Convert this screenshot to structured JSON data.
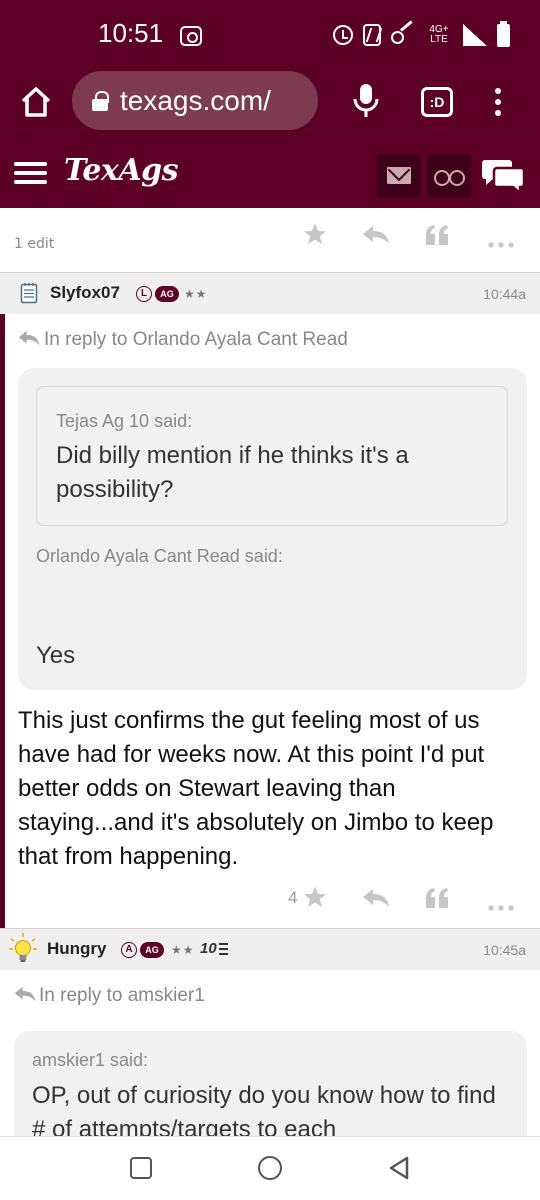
{
  "status_bar": {
    "time": "10:51",
    "network_label": "4G+ LTE"
  },
  "browser": {
    "url": "texags.com/",
    "tabs_label": ":D"
  },
  "site_header": {
    "logo_text": "TexAgs"
  },
  "prev_post": {
    "edit_label": "1 edit"
  },
  "posts": [
    {
      "username": "Slyfox07",
      "badge_letter": "L",
      "badge_ag": "AG",
      "stars": "★★",
      "time": "10:44a",
      "reply_to": "In reply to Orlando Ayala Cant Read",
      "inner_quote_said": "Tejas Ag 10 said:",
      "inner_quote_text": "Did billy mention if he thinks it's a possibility?",
      "outer_quote_said": "Orlando Ayala Cant Read said:",
      "outer_quote_text": "Yes",
      "body": "This just confirms the gut feeling most of us have had for weeks now. At this point I'd put better odds on Stewart leaving than staying...and it's absolutely on Jimbo to keep that from happening.",
      "star_count": "4"
    },
    {
      "username": "Hungry",
      "badge_letter": "A",
      "badge_ag": "AG",
      "stars": "★★",
      "extra_badge": "10",
      "time": "10:45a",
      "reply_to": "In reply to amskier1",
      "quote_said": "amskier1 said:",
      "quote_text": "OP, out of curiosity do you know how to find # of attempts/targets to each"
    }
  ],
  "colors": {
    "maroon": "#5c0025",
    "maroon_dark": "#3f0019",
    "icon_gray": "#c6c6c6"
  },
  "icons": [
    "home-icon",
    "lock-icon",
    "mic-icon",
    "tabs-icon",
    "more-vert-icon",
    "menu-icon",
    "mail-icon",
    "binoculars-icon",
    "chat-icon",
    "star-icon",
    "reply-icon",
    "quote-icon",
    "more-horiz-icon",
    "notepad-icon",
    "lightbulb-icon"
  ]
}
